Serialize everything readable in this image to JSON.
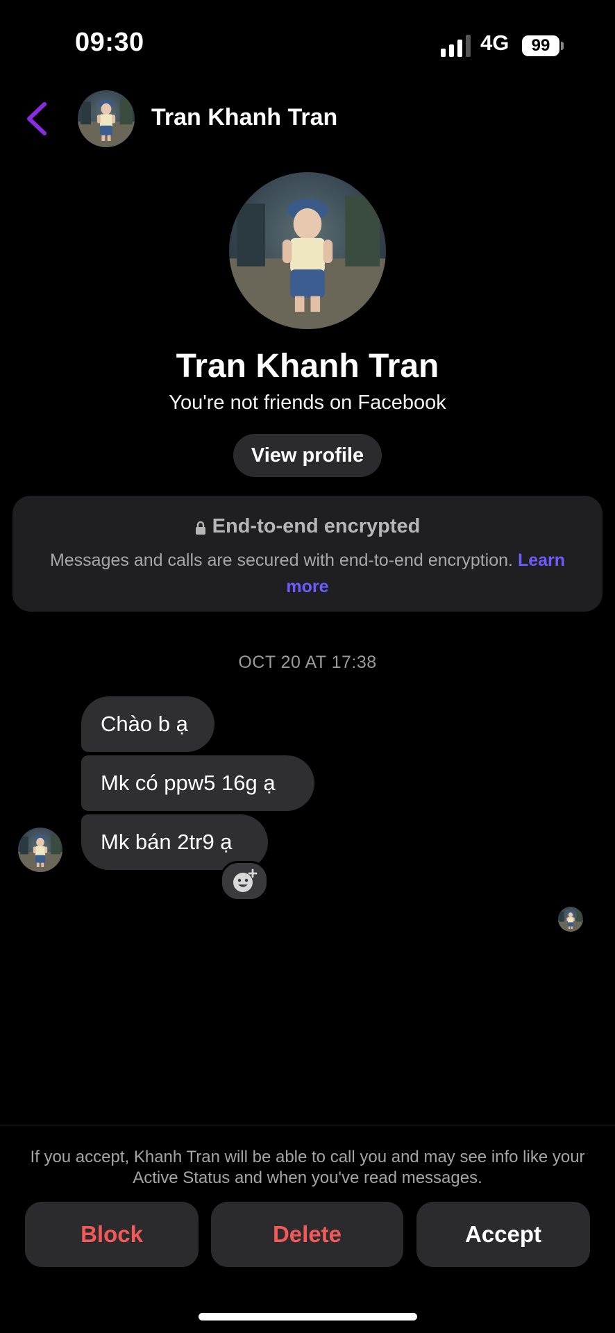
{
  "status_bar": {
    "time": "09:30",
    "network": "4G",
    "battery": "99"
  },
  "header": {
    "contact_name": "Tran Khanh Tran"
  },
  "profile": {
    "name": "Tran Khanh Tran",
    "relationship": "You're not friends on Facebook",
    "view_profile_label": "View profile"
  },
  "encryption": {
    "title": "End-to-end encrypted",
    "body": "Messages and calls are secured with end-to-end encryption. ",
    "link": "Learn more"
  },
  "thread": {
    "timestamp": "OCT 20 AT 17:38",
    "messages": [
      "Chào b ạ",
      "Mk có ppw5 16g ạ",
      "Mk bán 2tr9 ạ"
    ]
  },
  "request": {
    "note": "If you accept, Khanh Tran will be able to call you and may see info like your Active Status and when you've read messages.",
    "block_label": "Block",
    "delete_label": "Delete",
    "accept_label": "Accept"
  },
  "colors": {
    "accent": "#8a2be2",
    "link": "#6e5bff",
    "danger": "#f25a5a",
    "bubble": "#2f2f31",
    "card": "#1f1f21"
  },
  "icons": [
    "back-chevron-icon",
    "lock-icon",
    "add-reaction-icon",
    "signal-icon",
    "battery-icon"
  ]
}
